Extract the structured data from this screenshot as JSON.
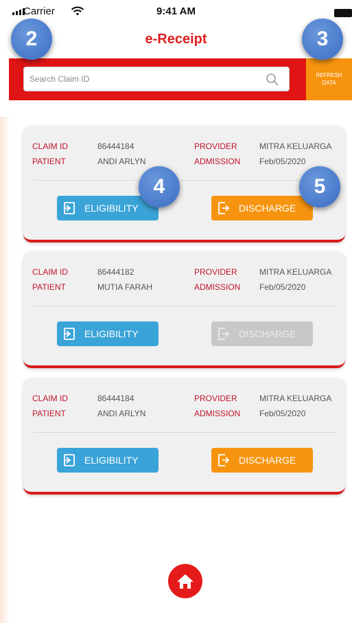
{
  "status_bar": {
    "carrier": "Carrier",
    "time": "9:41 AM"
  },
  "header": {
    "title": "e-Receipt"
  },
  "search": {
    "placeholder": "Search Claim ID"
  },
  "refresh": {
    "line1": "REFRESH",
    "line2": "DATA"
  },
  "labels": {
    "claim_id": "CLAIM ID",
    "patient": "PATIENT",
    "provider": "PROVIDER",
    "admission": "ADMISSION"
  },
  "buttons": {
    "eligibility": "ELIGIBILITY",
    "discharge": "DISCHARGE"
  },
  "claims": [
    {
      "claim_id": "86444184",
      "patient": "ANDI ARLYN",
      "provider": "MITRA KELUARGA",
      "admission": "Feb/05/2020",
      "discharge_enabled": true
    },
    {
      "claim_id": "86444182",
      "patient": "MUTIA FARAH",
      "provider": "MITRA KELUARGA",
      "admission": "Feb/05/2020",
      "discharge_enabled": false
    },
    {
      "claim_id": "86444184",
      "patient": "ANDI ARLYN",
      "provider": "MITRA KELUARGA",
      "admission": "Feb/05/2020",
      "discharge_enabled": true
    }
  ],
  "badges": [
    "2",
    "3",
    "4",
    "5"
  ],
  "colors": {
    "brand_red": "#e01414",
    "accent_orange": "#f7940f",
    "eligibility_blue": "#3aa4d8",
    "disabled_grey": "#c8c8c8",
    "badge_blue": "#4a7dd0"
  },
  "icons": {
    "signal": "signal-icon",
    "wifi": "wifi-icon",
    "battery": "battery-icon",
    "search": "search-icon",
    "eligibility": "login-icon",
    "discharge": "logout-icon",
    "home": "home-icon"
  }
}
